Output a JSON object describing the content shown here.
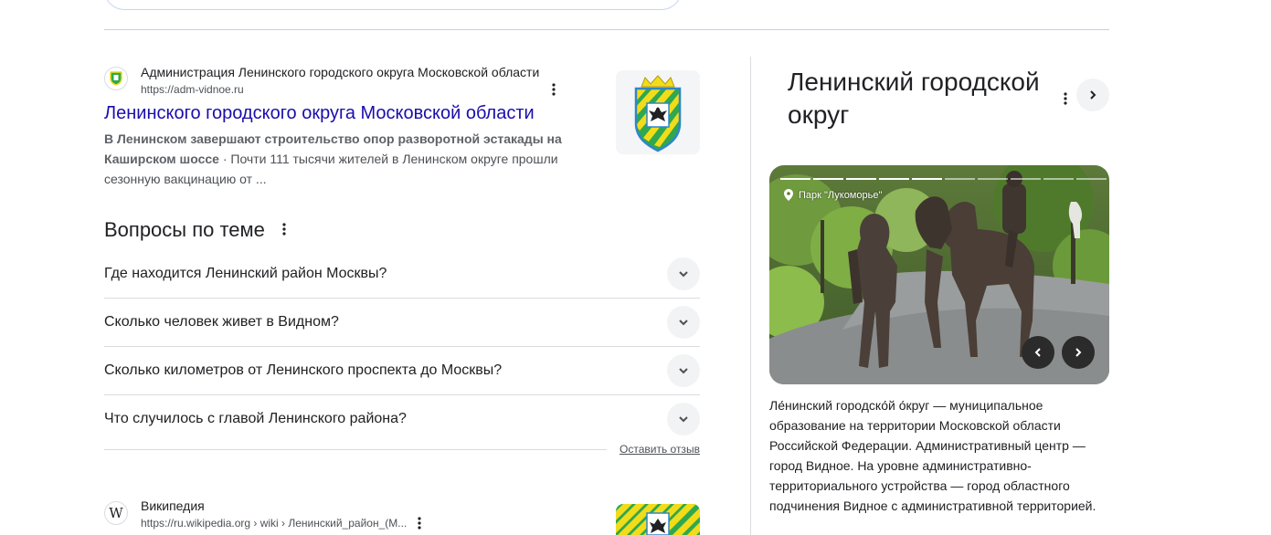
{
  "result1": {
    "site_name": "Администрация Ленинского городского округа Московской области",
    "url": "https://adm-vidnoe.ru",
    "title": "Ленинского городского округа Московской области",
    "snippet_bold": "В Ленинском завершают строительство опор разворотной эстакады на Каширском шоссе",
    "snippet_rest": " · Почти 111 тысячи жителей в Ленинском округе прошли сезонную вакцинацию от ..."
  },
  "paa": {
    "title": "Вопросы по теме",
    "questions": [
      "Где находится Ленинский район Москвы?",
      "Сколько человек живет в Видном?",
      "Сколько километров от Ленинского проспекта до Москвы?",
      "Что случилось с главой Ленинского района?"
    ],
    "feedback": "Оставить отзыв"
  },
  "knowledge_panel": {
    "title": "Ленинский городской округ",
    "image_caption": "Парк \"Лукоморье\"",
    "image_count": 10,
    "active_image": 5,
    "description": "Ле́нинский городско́й о́круг — муниципальное образование на территории Московской области Российской Федерации. Административный центр — город Видное. На уровне административно-территориального устройства — город областного подчинения Видное с административной территорией."
  },
  "result2": {
    "site_name": "Википедия",
    "url": "https://ru.wikipedia.org › wiki › Ленинский_район_(М...",
    "favicon_letter": "W"
  },
  "colors": {
    "link": "#1a0dab",
    "text": "#202124",
    "muted": "#4d5156",
    "chip": "#f1f3f4",
    "coat_yellow": "#f2dc1a",
    "coat_green": "#2fa84f",
    "coat_blue": "#2f86c8"
  }
}
